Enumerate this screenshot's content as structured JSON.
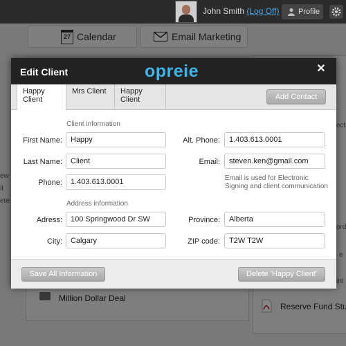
{
  "topbar": {
    "user_name": "John Smith",
    "logoff_label": "(Log Off)",
    "profile_label": "Profile",
    "profile_icon": "user-icon",
    "settings_icon": "gear-icon"
  },
  "nav": {
    "calendar_label": "Calendar",
    "calendar_icon_day": "27",
    "email_label": "Email Marketing"
  },
  "background": {
    "deal_label": "Million Dollar Deal",
    "reserve_label": "Reserve Fund Study",
    "left_edge_fragments": [
      "ew",
      "it",
      "ete"
    ],
    "right_edge_fragments": [
      "ect",
      "ord",
      "e",
      "int"
    ]
  },
  "modal": {
    "title": "Edit Client",
    "logo": "opreie",
    "tabs": [
      {
        "label": "Happy Client",
        "active": true
      },
      {
        "label": "Mrs Client",
        "active": false
      },
      {
        "label": "Happy Client",
        "active": false
      }
    ],
    "add_contact_label": "Add Contact",
    "client_section": "Client information",
    "address_section": "Address information",
    "fields": {
      "first_name": {
        "label": "First Name:",
        "value": "Happy"
      },
      "last_name": {
        "label": "Last Name:",
        "value": "Client"
      },
      "phone": {
        "label": "Phone:",
        "value": "1.403.613.0001"
      },
      "alt_phone": {
        "label": "Alt. Phone:",
        "value": "1.403.613.0001"
      },
      "email": {
        "label": "Email:",
        "value": "steven.ken@gmail.com"
      },
      "address": {
        "label": "Adress:",
        "value": "100 Springwood Dr SW"
      },
      "city": {
        "label": "City:",
        "value": "Calgary"
      },
      "province": {
        "label": "Province:",
        "value": "Alberta"
      },
      "zip": {
        "label": "ZIP code:",
        "value": "T2W T2W"
      }
    },
    "email_note": "Email is used for Electronic Signing and client communication",
    "save_label": "Save All Information",
    "delete_label": "Delete 'Happy Client'"
  },
  "colors": {
    "accent": "#3fb4ea",
    "header": "#222222",
    "link": "#4fa4e6"
  }
}
